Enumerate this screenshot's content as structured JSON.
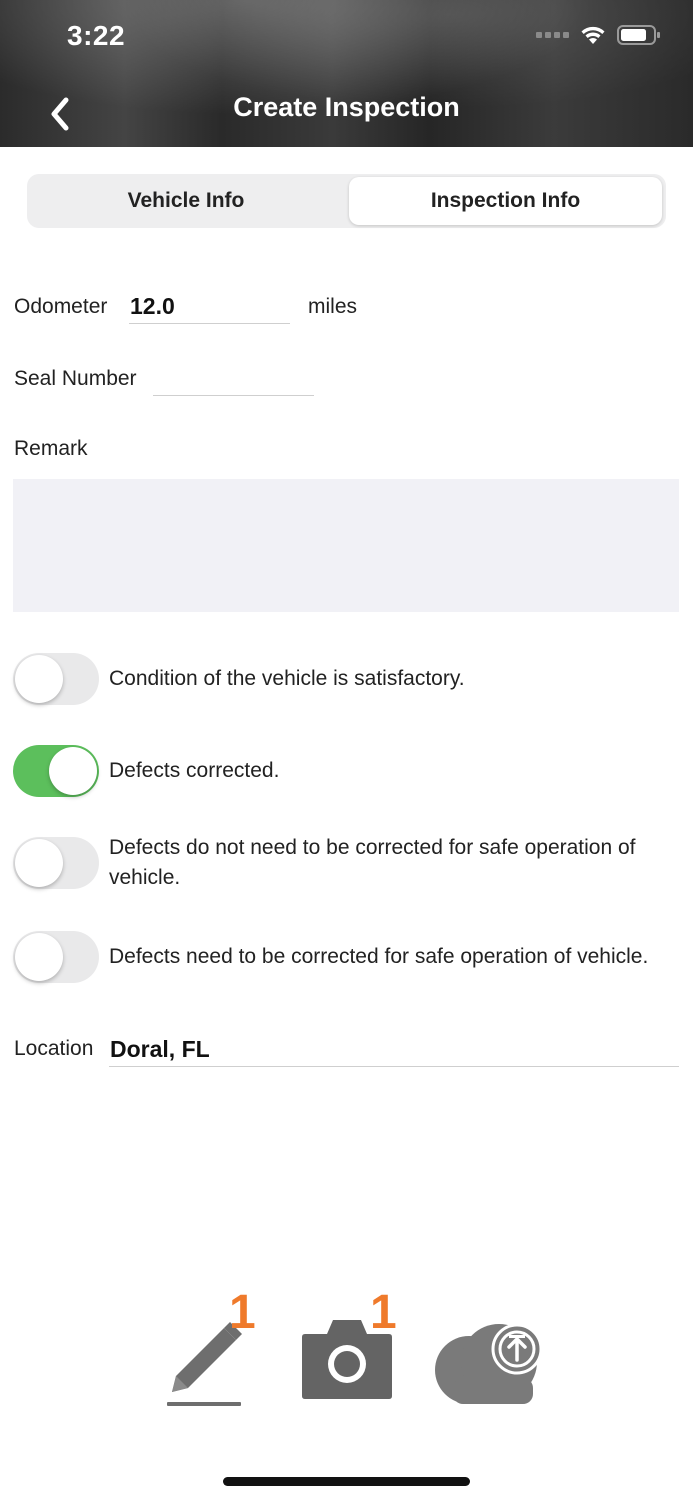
{
  "status_bar": {
    "time": "3:22"
  },
  "header": {
    "title": "Create Inspection"
  },
  "tabs": [
    {
      "label": "Vehicle Info",
      "selected": false
    },
    {
      "label": "Inspection Info",
      "selected": true
    }
  ],
  "form": {
    "odometer": {
      "label": "Odometer",
      "value": "12.0",
      "unit": "miles"
    },
    "seal_number": {
      "label": "Seal Number",
      "value": ""
    },
    "remark": {
      "label": "Remark",
      "value": ""
    },
    "toggles": [
      {
        "label": "Condition of the vehicle is satisfactory.",
        "on": false
      },
      {
        "label": "Defects corrected.",
        "on": true
      },
      {
        "label": "Defects do not need to be corrected for safe operation of vehicle.",
        "on": false
      },
      {
        "label": "Defects need to be corrected for safe operation of vehicle.",
        "on": false
      }
    ],
    "location": {
      "label": "Location",
      "value": "Doral, FL"
    }
  },
  "bottom_actions": {
    "signature_count": "1",
    "photo_count": "1"
  },
  "colors": {
    "toggle_on": "#5cbf5c",
    "badge": "#ef7a2b"
  }
}
